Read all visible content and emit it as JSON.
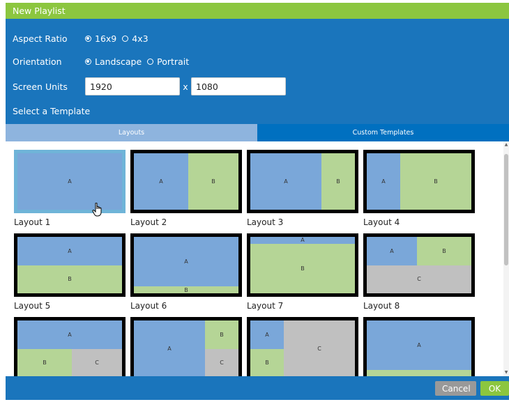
{
  "dialog": {
    "title": "New Playlist"
  },
  "form": {
    "aspect_ratio": {
      "label": "Aspect Ratio",
      "options": [
        "16x9",
        "4x3"
      ],
      "selected": "16x9"
    },
    "orientation": {
      "label": "Orientation",
      "options": [
        "Landscape",
        "Portrait"
      ],
      "selected": "Landscape"
    },
    "screen_units": {
      "label": "Screen Units",
      "width": "1920",
      "separator": "x",
      "height": "1080"
    },
    "template_heading": "Select a Template"
  },
  "tabs": [
    {
      "label": "Layouts",
      "active": true
    },
    {
      "label": "Custom Templates",
      "active": false
    }
  ],
  "layouts": [
    {
      "label": "Layout 1",
      "selected": true
    },
    {
      "label": "Layout 2"
    },
    {
      "label": "Layout 3"
    },
    {
      "label": "Layout 4"
    },
    {
      "label": "Layout 5"
    },
    {
      "label": "Layout 6"
    },
    {
      "label": "Layout 7"
    },
    {
      "label": "Layout 8"
    },
    {
      "label": ""
    },
    {
      "label": ""
    },
    {
      "label": ""
    },
    {
      "label": ""
    }
  ],
  "regions": {
    "a": "A",
    "b": "B",
    "c": "C"
  },
  "colors": {
    "title_green": "#8cc63f",
    "form_blue": "#1a75bc",
    "tab_active": "#8eb4de",
    "tab_inactive": "#0070c0",
    "region_blue": "#7aa7d9",
    "region_green": "#b5d596",
    "region_gray": "#c0c0c0"
  },
  "footer": {
    "cancel_label": "Cancel",
    "ok_label": "OK"
  }
}
